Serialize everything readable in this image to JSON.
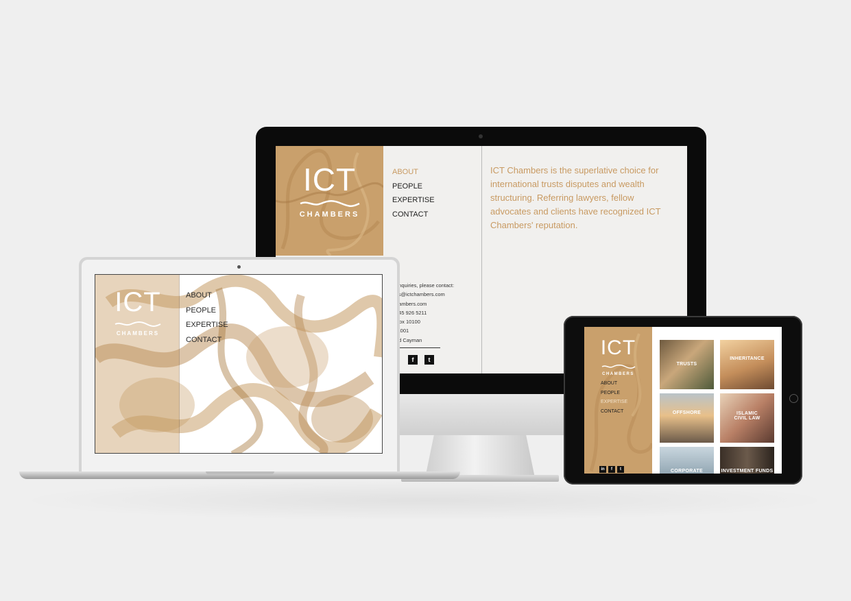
{
  "brand": {
    "logo_main": "ICT",
    "logo_sub": "CHAMBERS"
  },
  "colors": {
    "accent": "#c89a62",
    "page_bg": "#efefef",
    "brand_panel": "#c9a06c"
  },
  "desktop": {
    "nav": [
      "ABOUT",
      "PEOPLE",
      "EXPERTISE",
      "CONTACT"
    ],
    "intro": "ICT Chambers is the superlative choice for international trusts disputes and wealth structuring. Referring lawyers, fellow advocates and clients have recognized ICT Chambers' reputation.",
    "contact": [
      "enquiries, please contact:",
      "ks@ictchambers.com",
      "hambers.com",
      "345 926 5211",
      "Box 10100",
      "-1001",
      "nd Cayman"
    ],
    "social": [
      "f",
      "t"
    ]
  },
  "laptop": {
    "nav": [
      "ABOUT",
      "PEOPLE",
      "EXPERTISE",
      "CONTACT"
    ]
  },
  "tablet": {
    "nav": [
      "ABOUT",
      "PEOPLE",
      "EXPERTISE",
      "CONTACT"
    ],
    "social": [
      "in",
      "f",
      "t"
    ],
    "tiles": [
      "TRUSTS",
      "INHERITANCE",
      "OFFSHORE",
      "ISLAMIC CIVIL LAW",
      "CORPORATE",
      "INVESTMENT FUNDS"
    ]
  },
  "icons": {
    "camera": "camera-dot",
    "social_linkedin": "linkedin-icon",
    "social_facebook": "facebook-icon",
    "social_twitter": "twitter-icon"
  }
}
